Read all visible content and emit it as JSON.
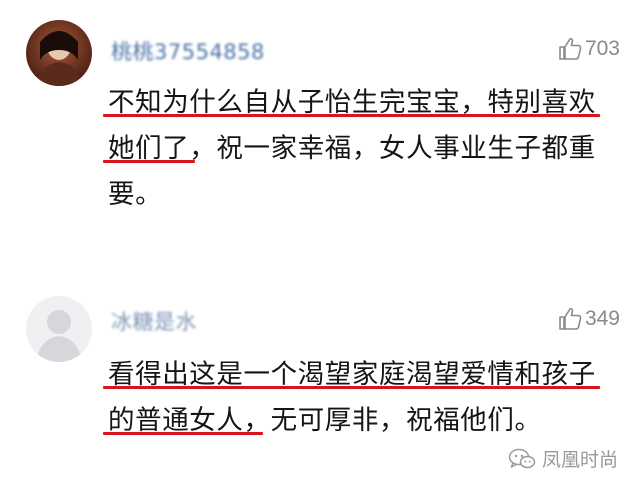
{
  "comments": [
    {
      "username": "桃桃37554858",
      "likes": "703",
      "lines": [
        "不知为什么自从子怡生完宝宝，特别喜欢",
        "她们了，祝一家幸福，女人事业生子都重",
        "要。"
      ]
    },
    {
      "username": "冰糖是水",
      "likes": "349",
      "lines": [
        "看得出这是一个渴望家庭渴望爱情和孩子",
        "的普通女人，无可厚非，祝福他们。"
      ]
    }
  ],
  "watermark": {
    "text": "凤凰时尚"
  },
  "colors": {
    "underline": "#d8141c",
    "username": "#4a72a8",
    "muted": "#8a8a8a"
  },
  "icons": {
    "like": "thumbs-up-icon",
    "watermark": "wechat-icon"
  }
}
